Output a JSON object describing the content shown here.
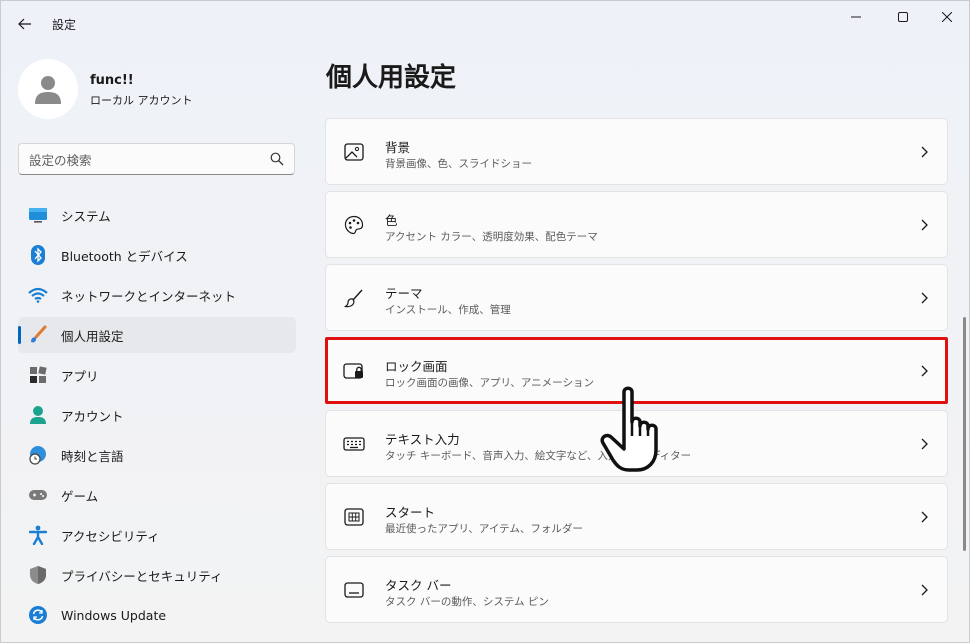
{
  "titlebar": {
    "app_title": "設定"
  },
  "profile": {
    "name": "func!!",
    "account_type": "ローカル アカウント"
  },
  "search": {
    "placeholder": "設定の検索"
  },
  "nav": {
    "items": [
      {
        "label": "システム",
        "icon": "monitor-icon"
      },
      {
        "label": "Bluetooth とデバイス",
        "icon": "bluetooth-icon"
      },
      {
        "label": "ネットワークとインターネット",
        "icon": "wifi-icon"
      },
      {
        "label": "個人用設定",
        "icon": "brush-icon",
        "selected": true
      },
      {
        "label": "アプリ",
        "icon": "apps-icon"
      },
      {
        "label": "アカウント",
        "icon": "person-icon"
      },
      {
        "label": "時刻と言語",
        "icon": "globe-clock-icon"
      },
      {
        "label": "ゲーム",
        "icon": "gamepad-icon"
      },
      {
        "label": "アクセシビリティ",
        "icon": "accessibility-icon"
      },
      {
        "label": "プライバシーとセキュリティ",
        "icon": "shield-icon"
      },
      {
        "label": "Windows Update",
        "icon": "update-icon"
      }
    ]
  },
  "main": {
    "title": "個人用設定",
    "cards": [
      {
        "title": "背景",
        "subtitle": "背景画像、色、スライドショー",
        "icon": "image-icon"
      },
      {
        "title": "色",
        "subtitle": "アクセント カラー、透明度効果、配色テーマ",
        "icon": "palette-icon"
      },
      {
        "title": "テーマ",
        "subtitle": "インストール、作成、管理",
        "icon": "brush-icon"
      },
      {
        "title": "ロック画面",
        "subtitle": "ロック画面の画像、アプリ、アニメーション",
        "icon": "lock-screen-icon",
        "highlighted": true
      },
      {
        "title": "テキスト入力",
        "subtitle": "タッチ キーボード、音声入力、絵文字など、入力方式エディター",
        "icon": "keyboard-icon"
      },
      {
        "title": "スタート",
        "subtitle": "最近使ったアプリ、アイテム、フォルダー",
        "icon": "start-icon"
      },
      {
        "title": "タスク バー",
        "subtitle": "タスク バーの動作、システム ピン",
        "icon": "taskbar-icon"
      }
    ]
  },
  "colors": {
    "accent": "#0067c0",
    "highlight_border": "#e01010"
  }
}
